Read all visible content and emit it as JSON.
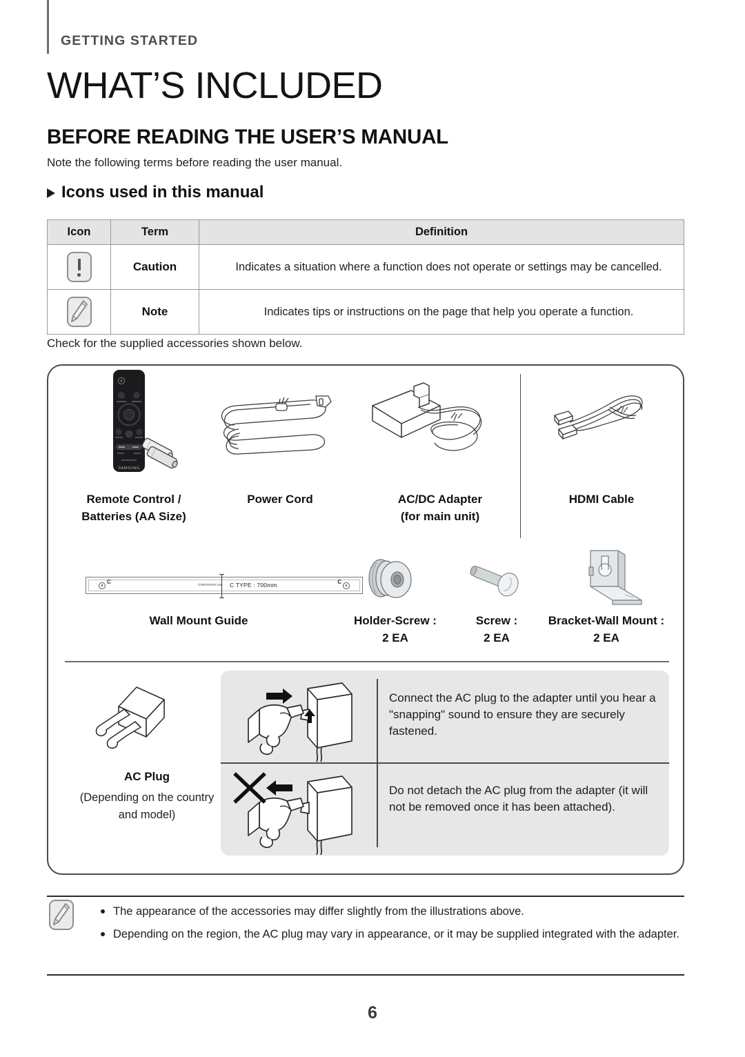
{
  "header": {
    "eyebrow": "GETTING STARTED",
    "title": "WHAT’S INCLUDED",
    "section_title": "BEFORE READING THE USER’S MANUAL",
    "lead": "Note the following terms before reading the user manual.",
    "subhead": "Icons used in this manual"
  },
  "icons_table": {
    "columns": [
      "Icon",
      "Term",
      "Definition"
    ],
    "rows": [
      {
        "icon": "caution-icon",
        "term": "Caution",
        "definition": "Indicates a situation where a function does not operate or settings may be cancelled."
      },
      {
        "icon": "note-icon",
        "term": "Note",
        "definition": "Indicates tips or instructions on the page that help you operate a function."
      }
    ]
  },
  "accessories": {
    "intro": "Check for the supplied accessories shown below.",
    "row1": [
      {
        "icon": "remote-control-icon",
        "label_line1": "Remote Control /",
        "label_line2": "Batteries (AA Size)"
      },
      {
        "icon": "power-cord-icon",
        "label_line1": "Power Cord",
        "label_line2": ""
      },
      {
        "icon": "ac-dc-adapter-icon",
        "label_line1": "AC/DC Adapter",
        "label_line2": "(for main unit)"
      },
      {
        "icon": "hdmi-cable-icon",
        "label_line1": "HDMI Cable",
        "label_line2": ""
      }
    ],
    "row2": [
      {
        "icon": "wall-mount-guide-icon",
        "label_line1": "Wall Mount Guide",
        "label_line2": ""
      },
      {
        "icon": "holder-screw-icon",
        "label_line1": "Holder-Screw :",
        "label_line2": "2 EA"
      },
      {
        "icon": "screw-icon",
        "label_line1": "Screw :",
        "label_line2": "2 EA"
      },
      {
        "icon": "bracket-wall-mount-icon",
        "label_line1": "Bracket-Wall Mount :",
        "label_line2": "2 EA"
      }
    ],
    "wall_mount_guide": {
      "type_label": "C TYPE : 700mm",
      "tiny_label": "CONTENTS:100",
      "marker_left": "C",
      "marker_right": "C"
    },
    "ac_plug": {
      "label": "AC Plug",
      "note_line1": "(Depending on the country",
      "note_line2": "and model)"
    },
    "instructions": [
      {
        "art": "hand-attach-plug-icon",
        "text": "Connect the AC plug to the adapter until you hear a \"snapping\" sound to ensure they are securely fastened."
      },
      {
        "art": "hand-detach-plug-forbidden-icon",
        "text": "Do not detach the AC plug from the adapter (it will not be removed once it has been attached)."
      }
    ]
  },
  "footer_note": {
    "icon": "note-icon",
    "items": [
      "The appearance of the accessories may differ slightly from the illustrations above.",
      "Depending on the region, the AC plug may vary in appearance, or it may be supplied integrated with the adapter."
    ]
  },
  "page_number": "6"
}
